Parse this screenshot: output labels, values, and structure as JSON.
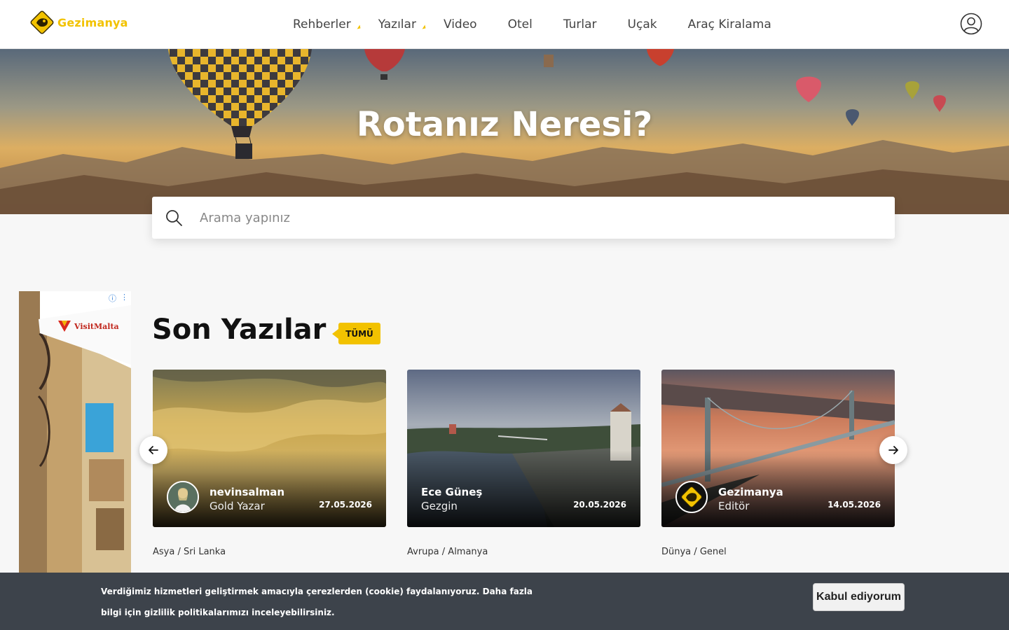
{
  "header": {
    "logo_text": "Gezimanya",
    "nav": [
      {
        "label": "Rehberler",
        "dropdown": true
      },
      {
        "label": "Yazılar",
        "dropdown": true
      },
      {
        "label": "Video",
        "dropdown": false
      },
      {
        "label": "Otel",
        "dropdown": false
      },
      {
        "label": "Turlar",
        "dropdown": false
      },
      {
        "label": "Uçak",
        "dropdown": false
      },
      {
        "label": "Araç Kiralama",
        "dropdown": false
      }
    ],
    "user_icon": "user-icon"
  },
  "hero": {
    "title": "Rotanız Neresi?"
  },
  "search": {
    "placeholder": "Arama yapınız",
    "value": ""
  },
  "ad": {
    "brand": "VisitMalta",
    "info_icon": "ⓘ",
    "menu_icon": "⋮"
  },
  "section": {
    "title": "Son Yazılar",
    "all_label": "TÜMÜ"
  },
  "cards": [
    {
      "author": "nevinsalman",
      "role": "Gold Yazar",
      "date": "27.05.2026",
      "breadcrumb": [
        "Asya",
        "Sri Lanka"
      ]
    },
    {
      "author": "Ece Güneş",
      "role": "Gezgin",
      "date": "20.05.2026",
      "breadcrumb": [
        "Avrupa",
        "Almanya"
      ]
    },
    {
      "author": "Gezimanya",
      "role": "Editör",
      "date": "14.05.2026",
      "breadcrumb": [
        "Dünya",
        "Genel"
      ]
    }
  ],
  "cookie": {
    "text": "Verdiğimiz hizmetleri geliştirmek amacıyla çerezlerden (cookie) faydalanıyoruz. Daha fazla bilgi için gizlilik politikalarımızı inceleyebilirsiniz.",
    "accept_label": "Kabul ediyorum"
  },
  "colors": {
    "brand_yellow": "#f2c200",
    "cookie_bg": "#3d434b",
    "text_dark": "#111111"
  }
}
